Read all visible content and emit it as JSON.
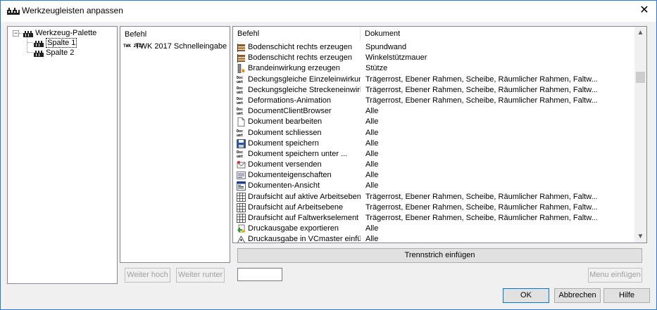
{
  "window": {
    "title": "Werkzeugleisten anpassen",
    "close_glyph": "✕"
  },
  "tree": {
    "root": "Werkzeug-Palette",
    "toggle": "−",
    "children": [
      "Spalte 1",
      "Spalte 2"
    ]
  },
  "left_list": {
    "header": "Befehl",
    "item_badge": "TWK 2017",
    "item_label": "TWK 2017 Schnelleingabe"
  },
  "command_table": {
    "columns": [
      "Befehl",
      "Dokument"
    ],
    "rows": [
      {
        "icon": "layer-icon",
        "cmd": "Bodenschicht rechts erzeugen",
        "doc": "Spundwand"
      },
      {
        "icon": "layer-icon",
        "cmd": "Bodenschicht rechts erzeugen",
        "doc": "Winkelstützmauer"
      },
      {
        "icon": "fire-column-icon",
        "cmd": "Brandeinwirkung erzeugen",
        "doc": "Stütze"
      },
      {
        "icon": "doc-icon",
        "cmd": "Deckungsgleiche Einzeleinwirkung...",
        "doc": "Trägerrost, Ebener Rahmen, Scheibe, Räumlicher Rahmen, Faltw..."
      },
      {
        "icon": "doc-icon",
        "cmd": "Deckungsgleiche Streckeneinwirku...",
        "doc": "Trägerrost, Ebener Rahmen, Scheibe, Räumlicher Rahmen, Faltw..."
      },
      {
        "icon": "doc-icon",
        "cmd": "Deformations-Animation",
        "doc": "Trägerrost, Ebener Rahmen, Scheibe, Räumlicher Rahmen, Faltw..."
      },
      {
        "icon": "doc-icon",
        "cmd": "DocumentClientBrowser",
        "doc": "Alle"
      },
      {
        "icon": "page-icon",
        "cmd": "Dokument bearbeiten",
        "doc": "Alle"
      },
      {
        "icon": "doc-icon",
        "cmd": "Dokument schliessen",
        "doc": "Alle"
      },
      {
        "icon": "floppy-icon",
        "cmd": "Dokument speichern",
        "doc": "Alle"
      },
      {
        "icon": "doc-icon",
        "cmd": "Dokument speichern unter ...",
        "doc": "Alle"
      },
      {
        "icon": "mail-icon",
        "cmd": "Dokument versenden",
        "doc": "Alle"
      },
      {
        "icon": "properties-icon",
        "cmd": "Dokumenteigenschaften",
        "doc": "Alle"
      },
      {
        "icon": "window-icon",
        "cmd": "Dokumenten-Ansicht",
        "doc": "Alle"
      },
      {
        "icon": "grid-icon",
        "cmd": "Draufsicht auf aktive Arbeitsebene",
        "doc": "Trägerrost, Ebener Rahmen, Scheibe, Räumlicher Rahmen, Faltw..."
      },
      {
        "icon": "grid-icon",
        "cmd": "Draufsicht auf Arbeitsebene",
        "doc": "Trägerrost, Ebener Rahmen, Scheibe, Räumlicher Rahmen, Faltw..."
      },
      {
        "icon": "grid-icon",
        "cmd": "Draufsicht auf Faltwerkselement",
        "doc": "Trägerrost, Ebener Rahmen, Scheibe, Räumlicher Rahmen, Faltw..."
      },
      {
        "icon": "export-print-icon",
        "cmd": "Druckausgabe exportieren",
        "doc": "Alle"
      },
      {
        "icon": "insert-print-icon",
        "cmd": "Druckausgabe in VCmaster einfügen",
        "doc": "Alle"
      }
    ]
  },
  "buttons": {
    "separator": "Trennstrich einfügen",
    "move_up": "Weiter hoch",
    "move_down": "Weiter runter",
    "menu_insert": "Menu einfügen",
    "ok": "OK",
    "cancel": "Abbrechen",
    "help": "Hilfe"
  },
  "scroll": {
    "up": "▲",
    "down": "▼"
  },
  "colors": {
    "accent": "#0078d7",
    "window_border": "#2b79d6"
  }
}
